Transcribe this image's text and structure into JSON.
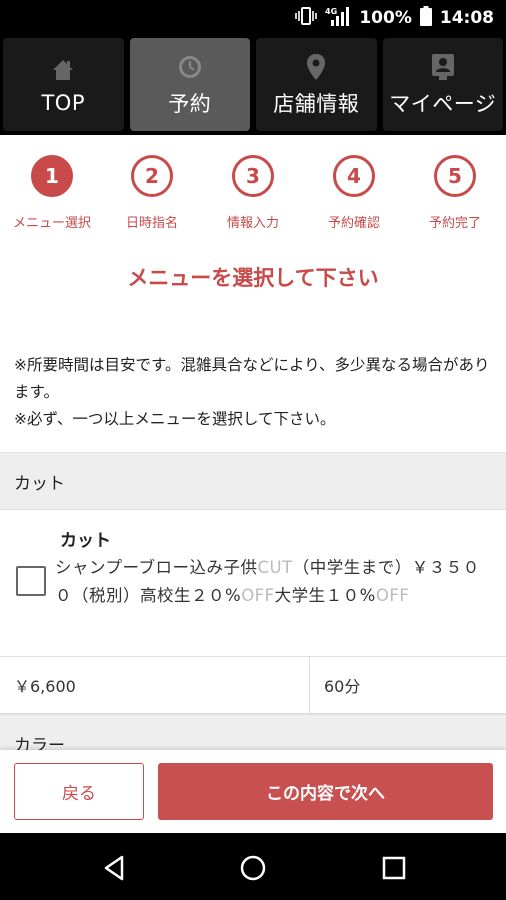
{
  "status_bar": {
    "battery": "100%",
    "time": "14:08",
    "signal_label": "4G"
  },
  "nav": {
    "items": [
      {
        "label": "TOP",
        "icon": "home-icon"
      },
      {
        "label": "予約",
        "icon": "clock-icon"
      },
      {
        "label": "店舗情報",
        "icon": "map-pin-icon"
      },
      {
        "label": "マイページ",
        "icon": "person-card-icon"
      }
    ],
    "active": "予約"
  },
  "steps": [
    {
      "number": "1",
      "label": "メニュー選択"
    },
    {
      "number": "2",
      "label": "日時指名"
    },
    {
      "number": "3",
      "label": "情報入力"
    },
    {
      "number": "4",
      "label": "予約確認"
    },
    {
      "number": "5",
      "label": "予約完了"
    }
  ],
  "headline": "メニューを選択して下さい",
  "notes": [
    "※所要時間は目安です。混雑具合などにより、多少異なる場合があります。",
    "※必ず、一つ以上メニューを選択して下さい。"
  ],
  "sections": [
    {
      "title": "カット",
      "items": [
        {
          "name": "カット",
          "desc_parts": [
            "シャンプーブロー込み子供",
            "CUT",
            "（中学生まで）￥３５００（税別）高校生２０%",
            "OFF",
            "大学生１０%",
            "OFF"
          ],
          "price": "￥6,600",
          "duration": "60分",
          "checked": false
        }
      ]
    },
    {
      "title": "カラー"
    }
  ],
  "footer": {
    "back_label": "戻る",
    "next_label": "この内容で次へ"
  },
  "colors": {
    "accent": "#c84a4a",
    "nav_bg": "#000000",
    "nav_active": "#5a5a5a",
    "section_bg": "#eeeeee"
  }
}
